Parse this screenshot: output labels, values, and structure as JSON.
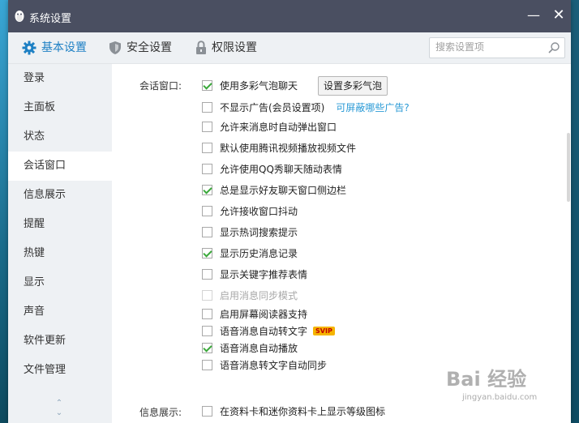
{
  "window": {
    "title": "系统设置"
  },
  "tabs": [
    {
      "label": "基本设置",
      "icon": "gear-icon",
      "active": true
    },
    {
      "label": "安全设置",
      "icon": "shield-icon",
      "active": false
    },
    {
      "label": "权限设置",
      "icon": "lock-icon",
      "active": false
    }
  ],
  "search": {
    "placeholder": "搜索设置项"
  },
  "sidebar": {
    "items": [
      {
        "label": "登录"
      },
      {
        "label": "主面板"
      },
      {
        "label": "状态"
      },
      {
        "label": "会话窗口",
        "active": true
      },
      {
        "label": "信息展示"
      },
      {
        "label": "提醒"
      },
      {
        "label": "热键"
      },
      {
        "label": "显示"
      },
      {
        "label": "声音"
      },
      {
        "label": "软件更新"
      },
      {
        "label": "文件管理"
      }
    ]
  },
  "main": {
    "section_chat": "会话窗口:",
    "section_info": "信息展示:",
    "bubble_button": "设置多彩气泡",
    "ads_link": "可屏蔽哪些广告?",
    "vip_badge": "SVIP",
    "options": [
      {
        "label": "使用多彩气泡聊天",
        "checked": true
      },
      {
        "label": "不显示广告(会员设置项)",
        "checked": false
      },
      {
        "label": "允许来消息时自动弹出窗口",
        "checked": false
      },
      {
        "label": "默认使用腾讯视频播放视频文件",
        "checked": false
      },
      {
        "label": "允许使用QQ秀聊天随动表情",
        "checked": false
      },
      {
        "label": "总是显示好友聊天窗口侧边栏",
        "checked": true
      },
      {
        "label": "允许接收窗口抖动",
        "checked": false
      },
      {
        "label": "显示热词搜索提示",
        "checked": false
      },
      {
        "label": "显示历史消息记录",
        "checked": true
      },
      {
        "label": "显示关键字推荐表情",
        "checked": false
      },
      {
        "label": "启用消息同步模式",
        "checked": false,
        "disabled": true
      },
      {
        "label": "启用屏幕阅读器支持",
        "checked": false
      },
      {
        "label": "语音消息自动转文字",
        "checked": false
      },
      {
        "label": "语音消息自动播放",
        "checked": true
      },
      {
        "label": "语音消息转文字自动同步",
        "checked": false
      }
    ],
    "info_option": {
      "label": "在资料卡和迷你资料卡上显示等级图标",
      "checked": false
    }
  },
  "watermark": {
    "text": "Bai 经验",
    "sub": "jingyan.baidu.com"
  },
  "colors": {
    "titlebar": "#4a4f61",
    "accent": "#1e80c4",
    "check": "#3aa83a",
    "link": "#2a9ad6"
  }
}
